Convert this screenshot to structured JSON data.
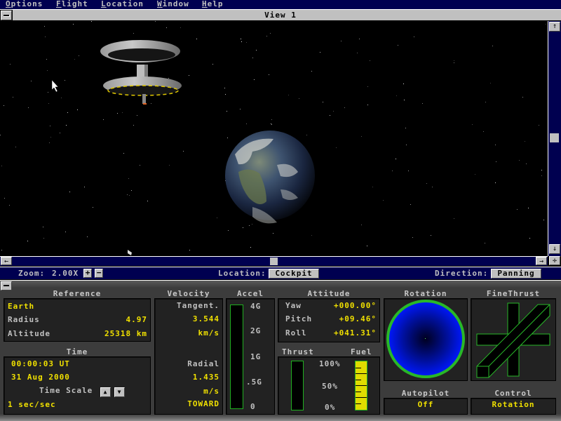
{
  "menu": {
    "items": [
      {
        "label": "Options",
        "accel": "O"
      },
      {
        "label": "Flight",
        "accel": "F"
      },
      {
        "label": "Location",
        "accel": "L"
      },
      {
        "label": "Window",
        "accel": "W"
      },
      {
        "label": "Help",
        "accel": "H"
      }
    ]
  },
  "view": {
    "title": "View 1",
    "scroll_up_glyph": "↑",
    "scroll_down_glyph": "↓",
    "scroll_left_glyph": "←",
    "scroll_right_glyph": "→",
    "corner_glyph": "✛",
    "scene_objects": [
      "space-station",
      "earth"
    ]
  },
  "infobar": {
    "zoom_label": "Zoom:",
    "zoom_value": "2.00X",
    "zoom_in": "+",
    "zoom_out": "−",
    "location_label": "Location:",
    "location_value": "Cockpit",
    "direction_label": "Direction:",
    "direction_value": "Panning"
  },
  "panel": {
    "reference": {
      "header": "Reference",
      "body": "Earth",
      "radius_label": "Radius",
      "radius_value": "4.97",
      "altitude_label": "Altitude",
      "altitude_value": "25318 km"
    },
    "time": {
      "header": "Time",
      "clock": "00:00:03 UT",
      "date": "31 Aug 2000",
      "scale_label": "Time Scale",
      "scale_up": "▲",
      "scale_down": "▼",
      "scale_value": "1 sec/sec"
    },
    "velocity": {
      "header": "Velocity",
      "tangent_label": "Tangent.",
      "tangent_value": "3.544",
      "tangent_unit": "km/s",
      "radial_label": "Radial",
      "radial_value": "1.435",
      "radial_unit": "m/s",
      "radial_direction": "TOWARD"
    },
    "accel": {
      "header": "Accel",
      "ticks": [
        "4G",
        "2G",
        "1G",
        ".5G",
        "0"
      ],
      "level_fraction": 0.0
    },
    "attitude": {
      "header": "Attitude",
      "yaw_label": "Yaw",
      "yaw_value": "+000.00°",
      "pitch_label": "Pitch",
      "pitch_value": "+09.46°",
      "roll_label": "Roll",
      "roll_value": "+041.31°"
    },
    "thrust": {
      "header": "Thrust",
      "ticks": [
        "100%",
        "50%",
        "0%"
      ],
      "level_fraction": 0.0
    },
    "fuel": {
      "header": "Fuel",
      "level_fraction": 1.0
    },
    "rotation": {
      "header": "Rotation"
    },
    "finethrust": {
      "header": "FineThrust"
    },
    "autopilot": {
      "header": "Autopilot",
      "value": "Off"
    },
    "control": {
      "header": "Control",
      "value": "Rotation"
    }
  },
  "colors": {
    "menu_bg": "#000050",
    "readout_yellow": "#f0e000",
    "gauge_green": "#20b020",
    "rotation_blue": "#0010ff"
  }
}
